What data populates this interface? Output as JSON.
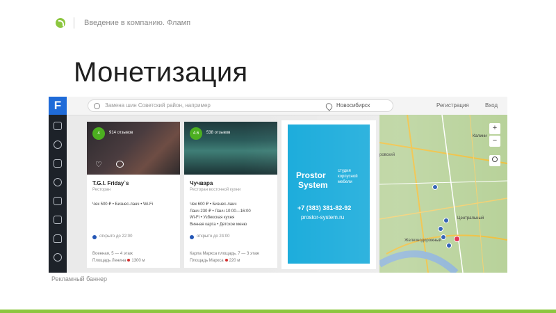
{
  "header": {
    "text": "Введение в компанию. Фламп"
  },
  "title": "Монетизация",
  "app": {
    "logo": "F",
    "nav_icons": [
      "cutlery-icon",
      "clothes-icon",
      "cup-icon",
      "pie-chart-icon",
      "clipboard-icon",
      "tv-icon",
      "car-icon",
      "target-icon"
    ],
    "search": {
      "placeholder": "Замена шин Советский район, например"
    },
    "city": "Новосибирск",
    "top_links": {
      "register": "Регистрация",
      "login": "Вход"
    },
    "cards": [
      {
        "rating": "4",
        "reviews": "914 отзывов",
        "name": "T.G.I. Friday`s",
        "category": "Ресторан",
        "lines": [
          "Чек 500 ₽ • Бизнес-ланч • Wi-Fi"
        ],
        "status": "открыто до 22:00",
        "address": [
          "Военная, 5 — 4 этаж",
          "Площадь Ленина",
          "1300 м"
        ]
      },
      {
        "rating": "4.6",
        "reviews": "538 отзывов",
        "name": "Чучвара",
        "category": "Ресторан восточной кухни",
        "lines": [
          "Чек 600 ₽ • Бизнес-ланч",
          "Ланч 230 ₽ • Ланч 10:00—16:00",
          "Wi-Fi • Узбекская кухня",
          "Винная карта • Детское меню"
        ],
        "status": "открыто до 24:00",
        "address": [
          "Карла Маркса площадь, 7 — 3 этаж",
          "Площадь Маркса",
          "220 м"
        ]
      }
    ],
    "ad": {
      "brand_line1": "Prostor",
      "brand_line2": "System",
      "tagline": [
        "студия",
        "корпусной",
        "мебели"
      ],
      "phone": "+7 (383) 381-82-92",
      "site": "prostor-system.ru"
    },
    "map": {
      "zoom_in": "+",
      "zoom_out": "−",
      "labels": {
        "district": "ровский",
        "central": "Центральный",
        "railway": "Железнодорожный",
        "kalinin": "Калини"
      }
    }
  },
  "caption": "Рекламный баннер",
  "colors": {
    "accent_green": "#8cc63f",
    "ad_blue": "#13a9da",
    "nav_dark": "#1d2229",
    "brand_blue": "#1f6bd8"
  }
}
